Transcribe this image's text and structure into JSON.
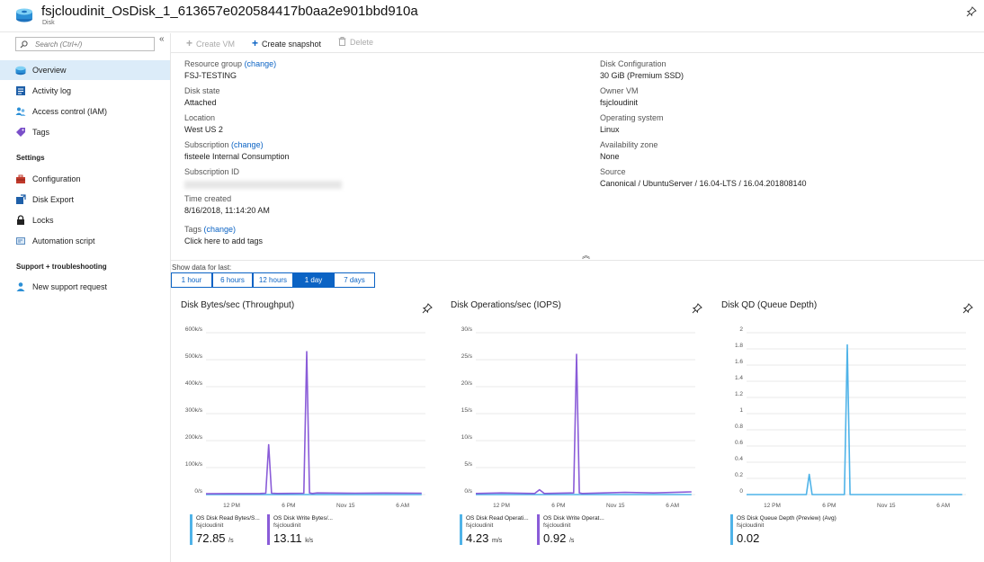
{
  "header": {
    "title": "fsjcloudinit_OsDisk_1_613657e020584417b0aa2e901bbd910a",
    "subtitle": "Disk"
  },
  "sidebar": {
    "search_placeholder": "Search (Ctrl+/)",
    "collapse_glyph": "«",
    "items": [
      {
        "label": "Overview",
        "icon": "disk-icon"
      },
      {
        "label": "Activity log",
        "icon": "activity-log-icon"
      },
      {
        "label": "Access control (IAM)",
        "icon": "people-icon"
      },
      {
        "label": "Tags",
        "icon": "tag-icon"
      }
    ],
    "settings_title": "Settings",
    "settings_items": [
      {
        "label": "Configuration",
        "icon": "toolbox-icon"
      },
      {
        "label": "Disk Export",
        "icon": "export-icon"
      },
      {
        "label": "Locks",
        "icon": "lock-icon"
      },
      {
        "label": "Automation script",
        "icon": "script-icon"
      }
    ],
    "support_title": "Support + troubleshooting",
    "support_items": [
      {
        "label": "New support request",
        "icon": "support-request-icon"
      }
    ]
  },
  "toolbar": {
    "create_vm": "Create VM",
    "create_snapshot": "Create snapshot",
    "delete": "Delete"
  },
  "essentials": {
    "resource_group_label": "Resource group",
    "resource_group_change": "(change)",
    "resource_group": "FSJ-TESTING",
    "disk_state_label": "Disk state",
    "disk_state": "Attached",
    "location_label": "Location",
    "location": "West US 2",
    "subscription_label": "Subscription",
    "subscription_change": "(change)",
    "subscription": "fisteele Internal Consumption",
    "subscription_id_label": "Subscription ID",
    "time_created_label": "Time created",
    "time_created": "8/16/2018, 11:14:20 AM",
    "tags_label": "Tags",
    "tags_change": "(change)",
    "tags_link": "Click here to add tags",
    "disk_config_label": "Disk Configuration",
    "disk_config": "30 GiB (Premium SSD)",
    "owner_vm_label": "Owner VM",
    "owner_vm": "fsjcloudinit",
    "os_label": "Operating system",
    "os": "Linux",
    "zone_label": "Availability zone",
    "zone": "None",
    "source_label": "Source",
    "source": "Canonical / UbuntuServer / 16.04-LTS / 16.04.201808140",
    "collapse_glyph": "︽"
  },
  "time_range": {
    "label": "Show data for last:",
    "options": [
      "1 hour",
      "6 hours",
      "12 hours",
      "1 day",
      "7 days"
    ],
    "selected": "1 day"
  },
  "colors": {
    "accent": "#0b63c4",
    "read_series": "#4fb3e8",
    "write_series": "#8a5cd8",
    "queue_series": "#4fb3e8"
  },
  "chart_data": [
    {
      "type": "line",
      "title": "Disk Bytes/sec (Throughput)",
      "y_ticks": [
        "0/s",
        "100k/s",
        "200k/s",
        "300k/s",
        "400k/s",
        "500k/s",
        "600k/s"
      ],
      "ylim": [
        0,
        600000
      ],
      "x_ticks": [
        "12 PM",
        "6 PM",
        "Nov 15",
        "6 AM"
      ],
      "x_tick_hours": [
        12,
        18,
        24,
        30
      ],
      "xlim_hours": [
        9.3,
        32.4
      ],
      "grid": true,
      "series": [
        {
          "name": "OS Disk Read Bytes/S...",
          "resource": "fsjcloudinit",
          "color": "#4fb3e8",
          "x_hours": [
            9.3,
            32.0
          ],
          "values": [
            0,
            0
          ]
        },
        {
          "name": "OS Disk Write Bytes/...",
          "resource": "fsjcloudinit",
          "color": "#8a5cd8",
          "x_hours": [
            9.3,
            15.0,
            15.6,
            15.9,
            16.2,
            16.8,
            19.6,
            19.9,
            20.2,
            20.5,
            21.0,
            25.0,
            28.0,
            32.0
          ],
          "values": [
            3000,
            4000,
            5000,
            185000,
            5000,
            4000,
            5000,
            530000,
            6000,
            4000,
            6000,
            5000,
            5500,
            5000
          ]
        }
      ],
      "legend": [
        {
          "name": "OS Disk Read Bytes/S...",
          "resource": "fsjcloudinit",
          "value": "72.85",
          "unit": "/s"
        },
        {
          "name": "OS Disk Write Bytes/...",
          "resource": "fsjcloudinit",
          "value": "13.11",
          "unit": "k/s"
        }
      ]
    },
    {
      "type": "line",
      "title": "Disk Operations/sec (IOPS)",
      "y_ticks": [
        "0/s",
        "5/s",
        "10/s",
        "15/s",
        "20/s",
        "25/s",
        "30/s"
      ],
      "ylim": [
        0,
        30
      ],
      "x_ticks": [
        "12 PM",
        "6 PM",
        "Nov 15",
        "6 AM"
      ],
      "x_tick_hours": [
        12,
        18,
        24,
        30
      ],
      "xlim_hours": [
        9.3,
        32.4
      ],
      "grid": true,
      "series": [
        {
          "name": "OS Disk Read Operati...",
          "resource": "fsjcloudinit",
          "color": "#4fb3e8",
          "x_hours": [
            9.3,
            32.0
          ],
          "values": [
            0,
            0
          ]
        },
        {
          "name": "OS Disk Write Operat...",
          "resource": "fsjcloudinit",
          "color": "#8a5cd8",
          "x_hours": [
            9.3,
            12.0,
            15.5,
            16.0,
            16.5,
            19.6,
            19.9,
            20.2,
            20.5,
            25.0,
            28.0,
            32.0
          ],
          "values": [
            0.2,
            0.3,
            0.2,
            0.9,
            0.2,
            0.3,
            26,
            0.3,
            0.2,
            0.4,
            0.3,
            0.5
          ]
        }
      ],
      "legend": [
        {
          "name": "OS Disk Read Operati...",
          "resource": "fsjcloudinit",
          "value": "4.23",
          "unit": "m/s"
        },
        {
          "name": "OS Disk Write Operat...",
          "resource": "fsjcloudinit",
          "value": "0.92",
          "unit": "/s"
        }
      ]
    },
    {
      "type": "line",
      "title": "Disk QD (Queue Depth)",
      "y_ticks": [
        "0",
        "0.2",
        "0.4",
        "0.6",
        "0.8",
        "1",
        "1.2",
        "1.4",
        "1.6",
        "1.8",
        "2"
      ],
      "ylim": [
        0,
        2
      ],
      "x_ticks": [
        "12 PM",
        "6 PM",
        "Nov 15",
        "6 AM"
      ],
      "x_tick_hours": [
        12,
        18,
        24,
        30
      ],
      "xlim_hours": [
        9.3,
        32.4
      ],
      "grid": true,
      "series": [
        {
          "name": "OS Disk Queue Depth (Preview) (Avg)",
          "resource": "fsjcloudinit",
          "color": "#4fb3e8",
          "x_hours": [
            9.3,
            15.0,
            15.6,
            15.9,
            16.2,
            16.8,
            19.6,
            19.9,
            20.2,
            20.5,
            25.0,
            32.0
          ],
          "values": [
            0,
            0,
            0,
            0.25,
            0,
            0,
            0,
            1.85,
            0,
            0,
            0,
            0
          ]
        }
      ],
      "legend": [
        {
          "name": "OS Disk Queue Depth (Preview) (Avg)",
          "resource": "fsjcloudinit",
          "value": "0.02",
          "unit": ""
        }
      ]
    }
  ]
}
